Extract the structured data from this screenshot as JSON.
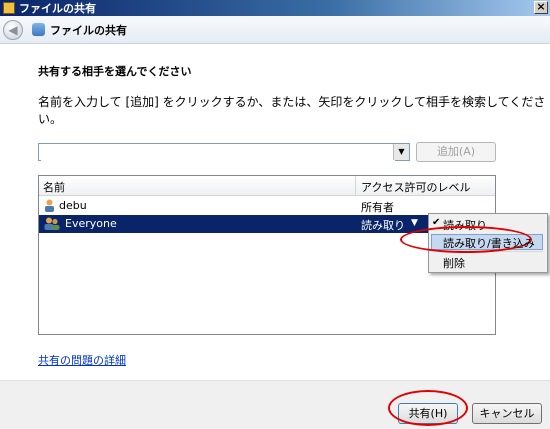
{
  "window": {
    "title": "ファイルの共有",
    "close_glyph": "×"
  },
  "nav": {
    "title": "ファイルの共有",
    "back_glyph": "◀"
  },
  "main": {
    "heading": "共有する相手を選んでください",
    "instruction": "名前を入力して [追加] をクリックするか、または、矢印をクリックして相手を検索してください。",
    "combo_value": "",
    "add_label": "追加(A)"
  },
  "table": {
    "columns": [
      "名前",
      "アクセス許可のレベル"
    ],
    "rows": [
      {
        "name": "debu",
        "permission": "所有者",
        "icon": "user-icon"
      },
      {
        "name": "Everyone",
        "permission": "読み取り",
        "icon": "group-icon"
      }
    ]
  },
  "context_menu": {
    "items": [
      "読み取り",
      "読み取り/書き込み",
      "削除"
    ],
    "checked": "読み取り",
    "highlighted": "読み取り/書き込み"
  },
  "help_link": "共有の問題の詳細",
  "footer": {
    "share_label": "共有(H)",
    "cancel_label": "キャンセル"
  },
  "colors": {
    "selection": "#0a246a",
    "annotation": "#e00000",
    "link": "#0033cc"
  }
}
